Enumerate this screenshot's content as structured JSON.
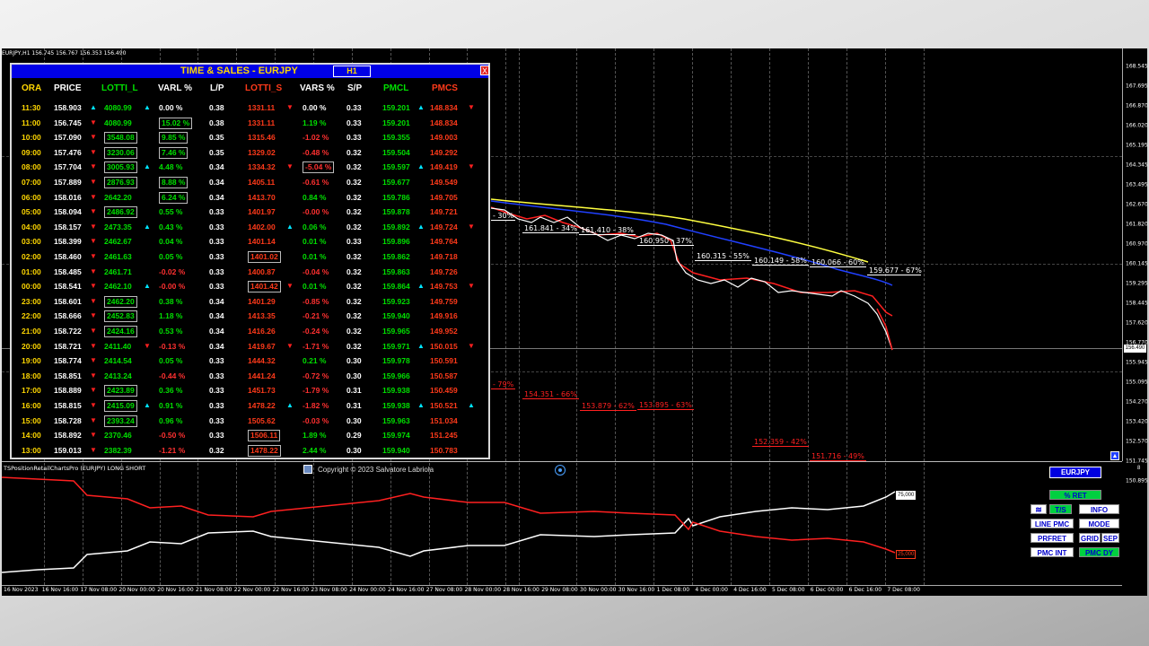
{
  "symbol_info": "EURJPY,H1 156.745 156.767 156.353 156.490",
  "panel": {
    "title": "TIME & SALES - EURJPY",
    "timeframe": "H1",
    "close": "X",
    "headers": [
      "ORA",
      "PRICE",
      "LOTTI_L",
      "VARL %",
      "L/P",
      "LOTTI_S",
      "VARS %",
      "S/P",
      "PMCL",
      "PMCS"
    ],
    "rows": [
      {
        "ora": "11:30",
        "price": "158.903",
        "pa": "up",
        "lotti_l": "4080.99",
        "la": "up",
        "varl": "0.00 %",
        "lp": "0.38",
        "lotti_s": "1331.11",
        "sa": "down",
        "vars": "0.00 %",
        "sp": "0.33",
        "pmcl": "159.201",
        "ca": "up",
        "pmcs": "148.834",
        "cs": "down"
      },
      {
        "ora": "11:00",
        "price": "156.745",
        "pa": "down",
        "lotti_l": "4080.99",
        "varl": "15.02 %",
        "varl_box": true,
        "lp": "0.38",
        "lotti_s": "1331.11",
        "vars": "1.19 %",
        "sp": "0.33",
        "pmcl": "159.201",
        "pmcs": "148.834"
      },
      {
        "ora": "10:00",
        "price": "157.090",
        "pa": "down",
        "lotti_l": "3548.08",
        "lotti_box": true,
        "varl": "9.85 %",
        "varl_box": true,
        "lp": "0.35",
        "lotti_s": "1315.46",
        "vars": "-1.02 %",
        "sp": "0.33",
        "pmcl": "159.355",
        "pmcs": "149.003"
      },
      {
        "ora": "09:00",
        "price": "157.476",
        "pa": "down",
        "lotti_l": "3230.06",
        "lotti_box": true,
        "varl": "7.46 %",
        "varl_box": true,
        "lp": "0.35",
        "lotti_s": "1329.02",
        "vars": "-0.48 %",
        "sp": "0.32",
        "pmcl": "159.504",
        "pmcs": "149.292"
      },
      {
        "ora": "08:00",
        "price": "157.704",
        "pa": "down",
        "lotti_l": "3005.93",
        "lotti_box": true,
        "la": "up",
        "varl": "4.48 %",
        "lp": "0.34",
        "lotti_s": "1334.32",
        "sa": "down",
        "vars": "-5.04 %",
        "vars_box": true,
        "sp": "0.32",
        "pmcl": "159.597",
        "ca": "up",
        "pmcs": "149.419",
        "cs": "down"
      },
      {
        "ora": "07:00",
        "price": "157.889",
        "pa": "down",
        "lotti_l": "2876.93",
        "lotti_box": true,
        "varl": "8.88 %",
        "varl_box": true,
        "lp": "0.34",
        "lotti_s": "1405.11",
        "vars": "-0.61 %",
        "sp": "0.32",
        "pmcl": "159.677",
        "pmcs": "149.549"
      },
      {
        "ora": "06:00",
        "price": "158.016",
        "pa": "down",
        "lotti_l": "2642.20",
        "varl": "6.24 %",
        "varl_box": true,
        "lp": "0.34",
        "lotti_s": "1413.70",
        "vars": "0.84 %",
        "sp": "0.32",
        "pmcl": "159.786",
        "pmcs": "149.705"
      },
      {
        "ora": "05:00",
        "price": "158.094",
        "pa": "down",
        "lotti_l": "2486.92",
        "lotti_box": true,
        "varl": "0.55 %",
        "lp": "0.33",
        "lotti_s": "1401.97",
        "vars": "-0.00 %",
        "sp": "0.32",
        "pmcl": "159.878",
        "pmcs": "149.721"
      },
      {
        "ora": "04:00",
        "price": "158.157",
        "pa": "down",
        "lotti_l": "2473.35",
        "la": "up",
        "varl": "0.43 %",
        "lp": "0.33",
        "lotti_s": "1402.00",
        "sa": "up",
        "vars": "0.06 %",
        "sp": "0.32",
        "pmcl": "159.892",
        "ca": "up",
        "pmcs": "149.724",
        "cs": "down"
      },
      {
        "ora": "03:00",
        "price": "158.399",
        "pa": "down",
        "lotti_l": "2462.67",
        "varl": "0.04 %",
        "lp": "0.33",
        "lotti_s": "1401.14",
        "vars": "0.01 %",
        "sp": "0.33",
        "pmcl": "159.896",
        "pmcs": "149.764"
      },
      {
        "ora": "02:00",
        "price": "158.460",
        "pa": "down",
        "lotti_l": "2461.63",
        "varl": "0.05 %",
        "lp": "0.33",
        "lotti_s": "1401.02",
        "lotti_s_box": true,
        "vars": "0.01 %",
        "sp": "0.32",
        "pmcl": "159.862",
        "pmcs": "149.718"
      },
      {
        "ora": "01:00",
        "price": "158.485",
        "pa": "down",
        "lotti_l": "2461.71",
        "varl": "-0.02 %",
        "lp": "0.33",
        "lotti_s": "1400.87",
        "vars": "-0.04 %",
        "sp": "0.32",
        "pmcl": "159.863",
        "pmcs": "149.726"
      },
      {
        "ora": "00:00",
        "price": "158.541",
        "pa": "down",
        "lotti_l": "2462.10",
        "la": "up",
        "varl": "-0.00 %",
        "lp": "0.33",
        "lotti_s": "1401.42",
        "lotti_s_box": true,
        "sa": "down",
        "vars": "0.01 %",
        "sp": "0.32",
        "pmcl": "159.864",
        "ca": "up",
        "pmcs": "149.753",
        "cs": "down"
      },
      {
        "ora": "23:00",
        "price": "158.601",
        "pa": "down",
        "lotti_l": "2462.20",
        "lotti_box": true,
        "varl": "0.38 %",
        "lp": "0.34",
        "lotti_s": "1401.29",
        "vars": "-0.85 %",
        "sp": "0.32",
        "pmcl": "159.923",
        "pmcs": "149.759"
      },
      {
        "ora": "22:00",
        "price": "158.666",
        "pa": "down",
        "lotti_l": "2452.83",
        "lotti_box": true,
        "varl": "1.18 %",
        "lp": "0.34",
        "lotti_s": "1413.35",
        "vars": "-0.21 %",
        "sp": "0.32",
        "pmcl": "159.940",
        "pmcs": "149.916"
      },
      {
        "ora": "21:00",
        "price": "158.722",
        "pa": "down",
        "lotti_l": "2424.16",
        "lotti_box": true,
        "varl": "0.53 %",
        "lp": "0.34",
        "lotti_s": "1416.26",
        "vars": "-0.24 %",
        "sp": "0.32",
        "pmcl": "159.965",
        "pmcs": "149.952"
      },
      {
        "ora": "20:00",
        "price": "158.721",
        "pa": "down",
        "lotti_l": "2411.40",
        "la": "down",
        "varl": "-0.13 %",
        "lp": "0.34",
        "lotti_s": "1419.67",
        "sa": "down",
        "vars": "-1.71 %",
        "sp": "0.32",
        "pmcl": "159.971",
        "ca": "up",
        "pmcs": "150.015",
        "cs": "down"
      },
      {
        "ora": "19:00",
        "price": "158.774",
        "pa": "down",
        "lotti_l": "2414.54",
        "varl": "0.05 %",
        "lp": "0.33",
        "lotti_s": "1444.32",
        "vars": "0.21 %",
        "sp": "0.30",
        "pmcl": "159.978",
        "pmcs": "150.591"
      },
      {
        "ora": "18:00",
        "price": "158.851",
        "pa": "down",
        "lotti_l": "2413.24",
        "varl": "-0.44 %",
        "lp": "0.33",
        "lotti_s": "1441.24",
        "vars": "-0.72 %",
        "sp": "0.30",
        "pmcl": "159.966",
        "pmcs": "150.587"
      },
      {
        "ora": "17:00",
        "price": "158.889",
        "pa": "down",
        "lotti_l": "2423.89",
        "lotti_box": true,
        "varl": "0.36 %",
        "lp": "0.33",
        "lotti_s": "1451.73",
        "vars": "-1.79 %",
        "sp": "0.31",
        "pmcl": "159.938",
        "pmcs": "150.459"
      },
      {
        "ora": "16:00",
        "price": "158.815",
        "pa": "down",
        "lotti_l": "2415.09",
        "lotti_box": true,
        "la": "up",
        "varl": "0.91 %",
        "lp": "0.33",
        "lotti_s": "1478.22",
        "sa": "up",
        "vars": "-1.82 %",
        "sp": "0.31",
        "pmcl": "159.938",
        "ca": "up",
        "pmcs": "150.521",
        "cs": "up"
      },
      {
        "ora": "15:00",
        "price": "158.728",
        "pa": "down",
        "lotti_l": "2393.24",
        "lotti_box": true,
        "varl": "0.96 %",
        "lp": "0.33",
        "lotti_s": "1505.62",
        "vars": "-0.03 %",
        "sp": "0.30",
        "pmcl": "159.963",
        "pmcs": "151.034"
      },
      {
        "ora": "14:00",
        "price": "158.892",
        "pa": "down",
        "lotti_l": "2370.46",
        "varl": "-0.50 %",
        "lp": "0.33",
        "lotti_s": "1506.11",
        "lotti_s_box": true,
        "vars": "1.89 %",
        "sp": "0.29",
        "pmcl": "159.974",
        "pmcs": "151.245"
      },
      {
        "ora": "13:00",
        "price": "159.013",
        "pa": "down",
        "lotti_l": "2382.39",
        "varl": "-1.21 %",
        "lp": "0.32",
        "lotti_s": "1478.22",
        "lotti_s_box": true,
        "vars": "2.44 %",
        "sp": "0.30",
        "pmcl": "159.940",
        "pmcs": "150.783"
      }
    ]
  },
  "price_axis": [
    "168.545",
    "167.695",
    "166.870",
    "166.020",
    "165.195",
    "164.345",
    "163.495",
    "162.670",
    "161.820",
    "160.970",
    "160.145",
    "159.295",
    "158.445",
    "157.620",
    "156.770",
    "155.945",
    "155.095",
    "154.270",
    "153.420",
    "152.570",
    "151.745",
    "150.895"
  ],
  "current_price": "156.490",
  "levels": {
    "white": [
      "- 30%",
      "161.841 - 34%",
      "161.410 - 38%",
      "160.950 - 37%",
      "160.315 - 55%",
      "160.149 - 58%",
      "160.066 - 60%",
      "159.677 - 67%"
    ],
    "red": [
      "- 79%",
      "154.351 - 66%",
      "153.879 - 62%",
      "153.895 - 63%",
      "152.359 - 42%",
      "151.716 - 49%"
    ]
  },
  "subchart": {
    "title": "TSPositionRetailChartsPro (EURJPY) LONG SHORT",
    "copyright": "Copyright © 2023 Salvatore Labriola",
    "long_value": "75,000",
    "short_value": "25,000",
    "right_tag": "8"
  },
  "time_axis": [
    "16 Nov 2023",
    "16 Nov 16:00",
    "17 Nov 08:00",
    "20 Nov 00:00",
    "20 Nov 16:00",
    "21 Nov 08:00",
    "22 Nov 00:00",
    "22 Nov 16:00",
    "23 Nov 08:00",
    "24 Nov 00:00",
    "24 Nov 16:00",
    "27 Nov 08:00",
    "28 Nov 00:00",
    "28 Nov 16:00",
    "29 Nov 08:00",
    "30 Nov 00:00",
    "30 Nov 16:00",
    "1 Dec 08:00",
    "4 Dec 00:00",
    "4 Dec 16:00",
    "5 Dec 08:00",
    "6 Dec 00:00",
    "6 Dec 16:00",
    "7 Dec 08:00"
  ],
  "controls": {
    "symbol_btn": "EURJPY",
    "ret_btn": "% RET",
    "ts_btn": "T/S",
    "info_btn": "INFO",
    "line_pmc_btn": "LINE PMC",
    "mode_btn": "MODE",
    "prfret_btn": "PRFRET",
    "grid_btn": "GRID",
    "sep_btn": "SEP",
    "pmc_int_btn": "PMC INT",
    "pmc_dy_btn": "PMC DY"
  },
  "colors": {
    "long": "#00e000",
    "short": "#ff3a1a",
    "gold": "#ffd700",
    "panel_title_bg": "#0000e6",
    "ma_yellow": "#ffff40",
    "ma_blue": "#2040ff"
  }
}
